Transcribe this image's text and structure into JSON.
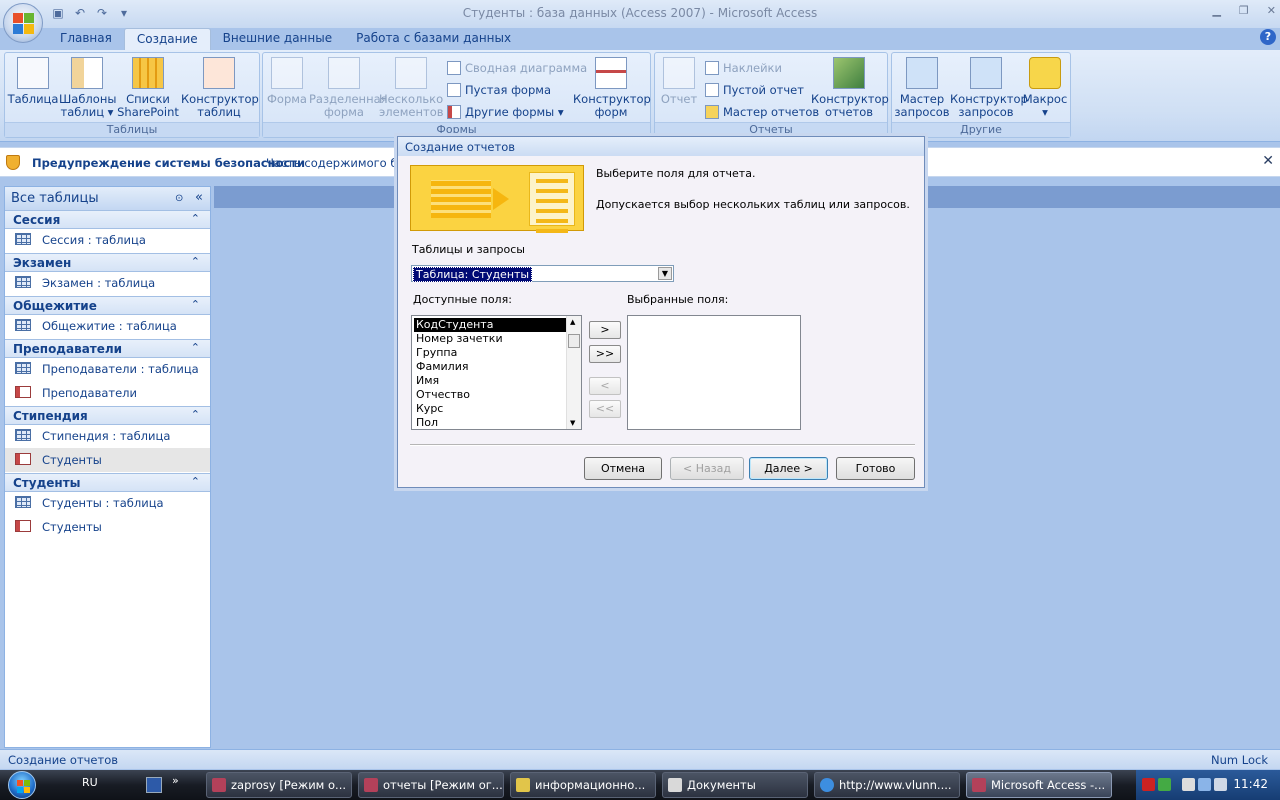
{
  "window": {
    "title": "Студенты : база данных (Access 2007) - Microsoft Access"
  },
  "tabs": [
    "Главная",
    "Создание",
    "Внешние данные",
    "Работа с базами данных"
  ],
  "ribbon": {
    "tables": {
      "caption": "Таблицы",
      "table": "Таблица",
      "templates_1": "Шаблоны",
      "templates_2": "таблиц ▾",
      "sharepoint_1": "Списки",
      "sharepoint_2": "SharePoint ▾",
      "designer_1": "Конструктор",
      "designer_2": "таблиц"
    },
    "forms": {
      "caption": "Формы",
      "form": "Форма",
      "split_1": "Разделенная",
      "split_2": "форма",
      "multi_1": "Несколько",
      "multi_2": "элементов",
      "pivot_chart": "Сводная диаграмма",
      "blank_form": "Пустая форма",
      "other_forms": "Другие формы ▾",
      "designer_1": "Конструктор",
      "designer_2": "форм"
    },
    "reports": {
      "caption": "Отчеты",
      "report": "Отчет",
      "labels": "Наклейки",
      "blank_report": "Пустой отчет",
      "wizard": "Мастер отчетов",
      "designer_1": "Конструктор",
      "designer_2": "отчетов"
    },
    "other": {
      "caption": "Другие",
      "query_wizard_1": "Мастер",
      "query_wizard_2": "запросов",
      "query_designer_1": "Конструктор",
      "query_designer_2": "запросов",
      "macro_1": "Макрос",
      "macro_2": "▾"
    }
  },
  "security": {
    "title": "Предупреждение системы безопасности",
    "text": "Часть содержимого базы"
  },
  "nav": {
    "title": "Все таблицы",
    "groups": [
      {
        "label": "Сессия",
        "items": [
          "Сессия : таблица"
        ]
      },
      {
        "label": "Экзамен",
        "items": [
          "Экзамен : таблица"
        ]
      },
      {
        "label": "Общежитие",
        "items": [
          "Общежитие : таблица"
        ]
      },
      {
        "label": "Преподаватели",
        "items": [
          "Преподаватели : таблица",
          "Преподаватели"
        ]
      },
      {
        "label": "Стипендия",
        "items": [
          "Стипендия : таблица",
          "Студенты"
        ]
      },
      {
        "label": "Студенты",
        "items": [
          "Студенты : таблица",
          "Студенты"
        ]
      }
    ]
  },
  "dialog": {
    "title": "Создание отчетов",
    "intro_1": "Выберите поля для отчета.",
    "intro_2": "Допускается выбор нескольких таблиц или запросов.",
    "tables_label": "Таблицы и запросы",
    "tables_value": "Таблица: Студенты",
    "available_label": "Доступные поля:",
    "selected_label": "Выбранные поля:",
    "available_fields": [
      "КодСтудента",
      "Номер зачетки",
      "Группа",
      "Фамилия",
      "Имя",
      "Отчество",
      "Курс",
      "Пол"
    ],
    "move_one": ">",
    "move_all": ">>",
    "remove_one": "<",
    "remove_all": "<<",
    "cancel": "Отмена",
    "back": "< Назад",
    "next": "Далее >",
    "finish": "Готово"
  },
  "status": {
    "left": "Создание отчетов",
    "right": "Num Lock"
  },
  "taskbar": {
    "lang": "RU",
    "buttons": [
      "zaprosy [Режим о...",
      "отчеты [Режим ог...",
      "информационно...",
      "Документы",
      "http://www.vlunn....",
      "Microsoft Access -..."
    ],
    "clock": "11:42"
  }
}
